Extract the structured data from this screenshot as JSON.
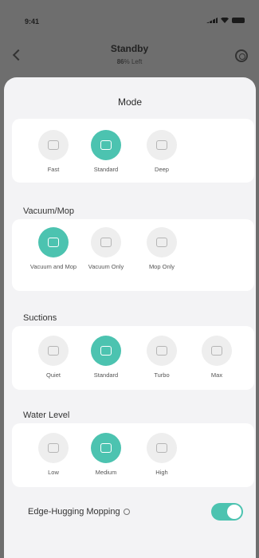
{
  "status": {
    "time": "9:41"
  },
  "header": {
    "title": "Standby",
    "subtitle_value": "86",
    "subtitle_suffix": "% Left"
  },
  "sheet": {
    "title": "Mode",
    "modes": [
      {
        "label": "Fast",
        "active": false
      },
      {
        "label": "Standard",
        "active": true
      },
      {
        "label": "Deep",
        "active": false
      }
    ],
    "vacuum_mop": {
      "label": "Vacuum/Mop",
      "options": [
        {
          "label": "Vacuum and Mop",
          "active": true
        },
        {
          "label": "Vacuum Only",
          "active": false
        },
        {
          "label": "Mop Only",
          "active": false
        }
      ]
    },
    "suction": {
      "label": "Suctions",
      "options": [
        {
          "label": "Quiet",
          "active": false
        },
        {
          "label": "Standard",
          "active": true
        },
        {
          "label": "Turbo",
          "active": false
        },
        {
          "label": "Max",
          "active": false
        }
      ]
    },
    "water": {
      "label": "Water Level",
      "options": [
        {
          "label": "Low",
          "active": false
        },
        {
          "label": "Medium",
          "active": true
        },
        {
          "label": "High",
          "active": false
        }
      ]
    },
    "edge": {
      "label": "Edge-Hugging Mopping",
      "enabled": true
    },
    "accent_color": "#4cc3b0"
  }
}
